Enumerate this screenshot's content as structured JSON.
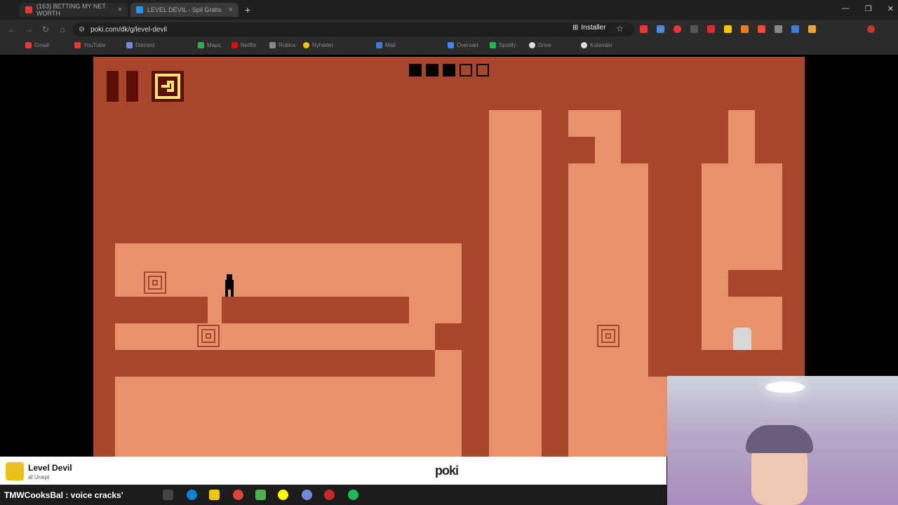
{
  "browser": {
    "tabs": [
      {
        "title": "(163) BETTING MY NET WORTH",
        "icon": "youtube-icon",
        "color": "#e53935"
      },
      {
        "title": "LEVEL DEVIL - Spil Gratis",
        "icon": "poki-icon",
        "color": "#2196f3"
      }
    ],
    "url": "poki.com/dk/g/level-devil",
    "install_label": "Installer",
    "bookmarks": [
      "Gmail",
      "YouTube",
      "Discord",
      "Maps",
      "Netflix",
      "Roblox",
      "Nyheder",
      "Mail",
      "Oversæt",
      "Spotify",
      "Drive",
      "Kalender"
    ]
  },
  "game": {
    "title": "Level Devil",
    "author": "af Unept",
    "publisher": "poki",
    "levels_total": 5,
    "levels_completed": 3,
    "colors": {
      "dark": "#a8462d",
      "light": "#e8916d",
      "ui": "#5e0f05",
      "accent": "#f5e96a"
    }
  },
  "taskbar": {
    "chat_text": "TMWCooksBal : voice cracks'"
  }
}
